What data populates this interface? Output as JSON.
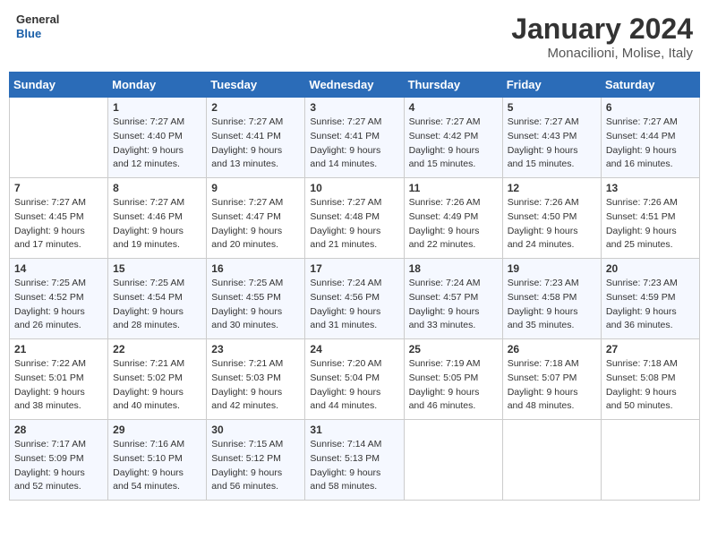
{
  "header": {
    "logo_line1": "General",
    "logo_line2": "Blue",
    "month": "January 2024",
    "location": "Monacilioni, Molise, Italy"
  },
  "weekdays": [
    "Sunday",
    "Monday",
    "Tuesday",
    "Wednesday",
    "Thursday",
    "Friday",
    "Saturday"
  ],
  "weeks": [
    [
      {
        "day": "",
        "info": ""
      },
      {
        "day": "1",
        "info": "Sunrise: 7:27 AM\nSunset: 4:40 PM\nDaylight: 9 hours\nand 12 minutes."
      },
      {
        "day": "2",
        "info": "Sunrise: 7:27 AM\nSunset: 4:41 PM\nDaylight: 9 hours\nand 13 minutes."
      },
      {
        "day": "3",
        "info": "Sunrise: 7:27 AM\nSunset: 4:41 PM\nDaylight: 9 hours\nand 14 minutes."
      },
      {
        "day": "4",
        "info": "Sunrise: 7:27 AM\nSunset: 4:42 PM\nDaylight: 9 hours\nand 15 minutes."
      },
      {
        "day": "5",
        "info": "Sunrise: 7:27 AM\nSunset: 4:43 PM\nDaylight: 9 hours\nand 15 minutes."
      },
      {
        "day": "6",
        "info": "Sunrise: 7:27 AM\nSunset: 4:44 PM\nDaylight: 9 hours\nand 16 minutes."
      }
    ],
    [
      {
        "day": "7",
        "info": "Sunrise: 7:27 AM\nSunset: 4:45 PM\nDaylight: 9 hours\nand 17 minutes."
      },
      {
        "day": "8",
        "info": "Sunrise: 7:27 AM\nSunset: 4:46 PM\nDaylight: 9 hours\nand 19 minutes."
      },
      {
        "day": "9",
        "info": "Sunrise: 7:27 AM\nSunset: 4:47 PM\nDaylight: 9 hours\nand 20 minutes."
      },
      {
        "day": "10",
        "info": "Sunrise: 7:27 AM\nSunset: 4:48 PM\nDaylight: 9 hours\nand 21 minutes."
      },
      {
        "day": "11",
        "info": "Sunrise: 7:26 AM\nSunset: 4:49 PM\nDaylight: 9 hours\nand 22 minutes."
      },
      {
        "day": "12",
        "info": "Sunrise: 7:26 AM\nSunset: 4:50 PM\nDaylight: 9 hours\nand 24 minutes."
      },
      {
        "day": "13",
        "info": "Sunrise: 7:26 AM\nSunset: 4:51 PM\nDaylight: 9 hours\nand 25 minutes."
      }
    ],
    [
      {
        "day": "14",
        "info": "Sunrise: 7:25 AM\nSunset: 4:52 PM\nDaylight: 9 hours\nand 26 minutes."
      },
      {
        "day": "15",
        "info": "Sunrise: 7:25 AM\nSunset: 4:54 PM\nDaylight: 9 hours\nand 28 minutes."
      },
      {
        "day": "16",
        "info": "Sunrise: 7:25 AM\nSunset: 4:55 PM\nDaylight: 9 hours\nand 30 minutes."
      },
      {
        "day": "17",
        "info": "Sunrise: 7:24 AM\nSunset: 4:56 PM\nDaylight: 9 hours\nand 31 minutes."
      },
      {
        "day": "18",
        "info": "Sunrise: 7:24 AM\nSunset: 4:57 PM\nDaylight: 9 hours\nand 33 minutes."
      },
      {
        "day": "19",
        "info": "Sunrise: 7:23 AM\nSunset: 4:58 PM\nDaylight: 9 hours\nand 35 minutes."
      },
      {
        "day": "20",
        "info": "Sunrise: 7:23 AM\nSunset: 4:59 PM\nDaylight: 9 hours\nand 36 minutes."
      }
    ],
    [
      {
        "day": "21",
        "info": "Sunrise: 7:22 AM\nSunset: 5:01 PM\nDaylight: 9 hours\nand 38 minutes."
      },
      {
        "day": "22",
        "info": "Sunrise: 7:21 AM\nSunset: 5:02 PM\nDaylight: 9 hours\nand 40 minutes."
      },
      {
        "day": "23",
        "info": "Sunrise: 7:21 AM\nSunset: 5:03 PM\nDaylight: 9 hours\nand 42 minutes."
      },
      {
        "day": "24",
        "info": "Sunrise: 7:20 AM\nSunset: 5:04 PM\nDaylight: 9 hours\nand 44 minutes."
      },
      {
        "day": "25",
        "info": "Sunrise: 7:19 AM\nSunset: 5:05 PM\nDaylight: 9 hours\nand 46 minutes."
      },
      {
        "day": "26",
        "info": "Sunrise: 7:18 AM\nSunset: 5:07 PM\nDaylight: 9 hours\nand 48 minutes."
      },
      {
        "day": "27",
        "info": "Sunrise: 7:18 AM\nSunset: 5:08 PM\nDaylight: 9 hours\nand 50 minutes."
      }
    ],
    [
      {
        "day": "28",
        "info": "Sunrise: 7:17 AM\nSunset: 5:09 PM\nDaylight: 9 hours\nand 52 minutes."
      },
      {
        "day": "29",
        "info": "Sunrise: 7:16 AM\nSunset: 5:10 PM\nDaylight: 9 hours\nand 54 minutes."
      },
      {
        "day": "30",
        "info": "Sunrise: 7:15 AM\nSunset: 5:12 PM\nDaylight: 9 hours\nand 56 minutes."
      },
      {
        "day": "31",
        "info": "Sunrise: 7:14 AM\nSunset: 5:13 PM\nDaylight: 9 hours\nand 58 minutes."
      },
      {
        "day": "",
        "info": ""
      },
      {
        "day": "",
        "info": ""
      },
      {
        "day": "",
        "info": ""
      }
    ]
  ]
}
